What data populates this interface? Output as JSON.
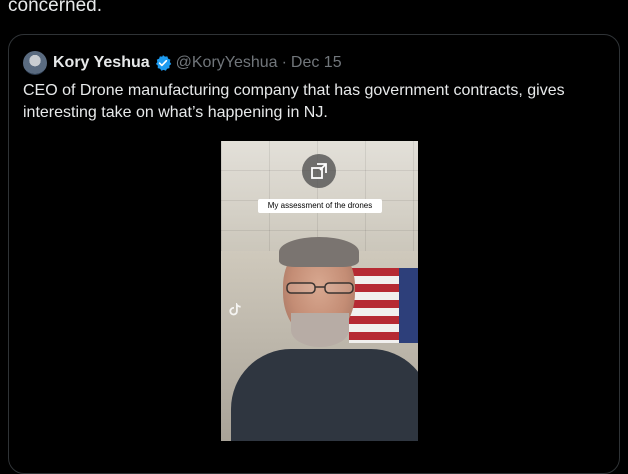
{
  "post": {
    "text_tail": "concerned."
  },
  "quote": {
    "author_name": "Kory Yeshua",
    "author_handle": "@KoryYeshua",
    "separator": "·",
    "date": "Dec 15",
    "text": "CEO of Drone manufacturing company that has government contracts, gives interesting take on what’s happening in NJ.",
    "verified_color": "#1d9bf0",
    "icons": [
      "avatar",
      "verified-badge-icon",
      "enlarge-media-icon",
      "tiktok-logo-icon"
    ]
  },
  "video": {
    "caption": "My assessment of the drones"
  }
}
